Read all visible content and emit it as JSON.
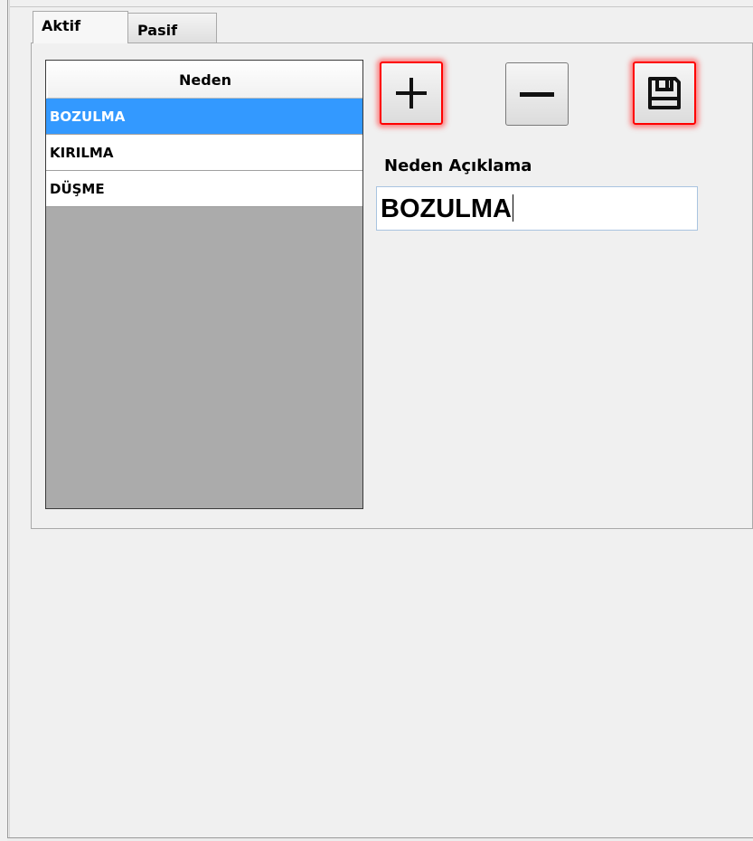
{
  "tabs": {
    "active_label": "Aktif",
    "inactive_label": "Pasif"
  },
  "grid": {
    "column_header": "Neden",
    "rows": [
      "BOZULMA",
      "KIRILMA",
      "DÜŞME"
    ],
    "selected_index": 0
  },
  "toolbar": {
    "add_icon": "plus-icon",
    "remove_icon": "minus-icon",
    "save_icon": "floppy-disk-icon"
  },
  "form": {
    "label": "Neden Açıklama",
    "value": "BOZULMA"
  },
  "colors": {
    "selection": "#3399ff",
    "highlight": "#ff0000"
  }
}
